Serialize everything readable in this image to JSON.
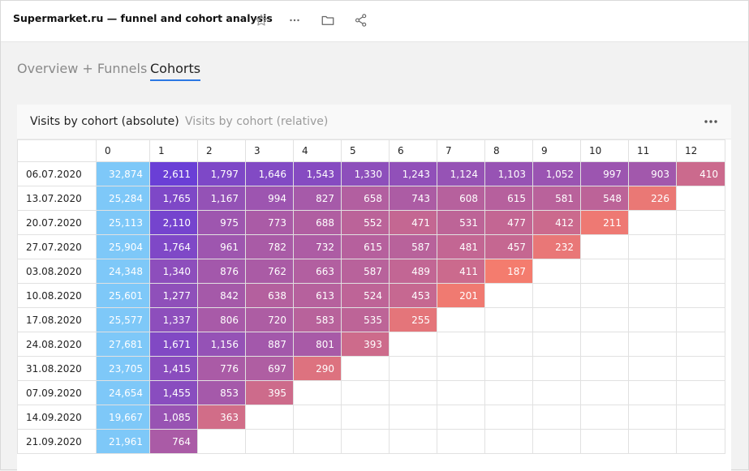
{
  "header": {
    "title": "Supermarket.ru — funnel and cohort analysis",
    "icons": [
      "star-icon",
      "more-horizontal-icon",
      "folder-icon",
      "share-icon"
    ]
  },
  "tabs": [
    {
      "label": "Overview + Funnels",
      "active": false
    },
    {
      "label": "Cohorts",
      "active": true
    }
  ],
  "panel": {
    "tabs": [
      {
        "label": "Visits by cohort (absolute)",
        "active": true
      },
      {
        "label": "Visits by cohort (relative)",
        "active": false
      }
    ],
    "more_icon": "more-horizontal-icon"
  },
  "colors": {
    "period0": "#7ec8f8",
    "high": "#6a3fd6",
    "low": "#f47c6e",
    "accent": "#2b78e4"
  },
  "cohort_table": {
    "columns": [
      "",
      "0",
      "1",
      "2",
      "3",
      "4",
      "5",
      "6",
      "7",
      "8",
      "9",
      "10",
      "11",
      "12"
    ],
    "rows": [
      {
        "date": "06.07.2020",
        "values": [
          "32,874",
          "2,611",
          "1,797",
          "1,646",
          "1,543",
          "1,330",
          "1,243",
          "1,124",
          "1,103",
          "1,052",
          "997",
          "903",
          "410"
        ]
      },
      {
        "date": "13.07.2020",
        "values": [
          "25,284",
          "1,765",
          "1,167",
          "994",
          "827",
          "658",
          "743",
          "608",
          "615",
          "581",
          "548",
          "226"
        ]
      },
      {
        "date": "20.07.2020",
        "values": [
          "25,113",
          "2,110",
          "975",
          "773",
          "688",
          "552",
          "471",
          "531",
          "477",
          "412",
          "211"
        ]
      },
      {
        "date": "27.07.2020",
        "values": [
          "25,904",
          "1,764",
          "961",
          "782",
          "732",
          "615",
          "587",
          "481",
          "457",
          "232"
        ]
      },
      {
        "date": "03.08.2020",
        "values": [
          "24,348",
          "1,340",
          "876",
          "762",
          "663",
          "587",
          "489",
          "411",
          "187"
        ]
      },
      {
        "date": "10.08.2020",
        "values": [
          "25,601",
          "1,277",
          "842",
          "638",
          "613",
          "524",
          "453",
          "201"
        ]
      },
      {
        "date": "17.08.2020",
        "values": [
          "25,577",
          "1,337",
          "806",
          "720",
          "583",
          "535",
          "255"
        ]
      },
      {
        "date": "24.08.2020",
        "values": [
          "27,681",
          "1,671",
          "1,156",
          "887",
          "801",
          "393"
        ]
      },
      {
        "date": "31.08.2020",
        "values": [
          "23,705",
          "1,415",
          "776",
          "697",
          "290"
        ]
      },
      {
        "date": "07.09.2020",
        "values": [
          "24,654",
          "1,455",
          "853",
          "395"
        ]
      },
      {
        "date": "14.09.2020",
        "values": [
          "19,667",
          "1,085",
          "363"
        ]
      },
      {
        "date": "21.09.2020",
        "values": [
          "21,961",
          "764"
        ]
      }
    ]
  }
}
